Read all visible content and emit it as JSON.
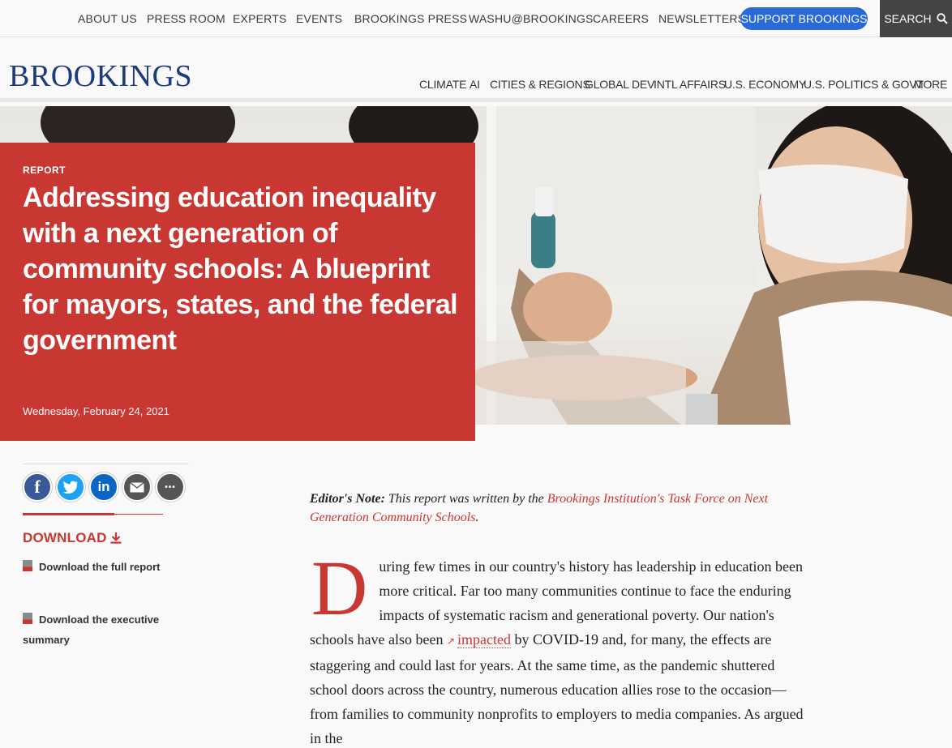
{
  "utility_nav": {
    "items": [
      "ABOUT US",
      "PRESS ROOM",
      "EXPERTS",
      "EVENTS",
      "BROOKINGS PRESS",
      "WASHU@BROOKINGS",
      "CAREERS",
      "NEWSLETTERS"
    ],
    "support_label": "SUPPORT BROOKINGS",
    "search_label": "SEARCH"
  },
  "brand": {
    "logo_text": "BROOKINGS"
  },
  "topic_nav": {
    "items": [
      "CLIMATE",
      "AI",
      "CITIES & REGIONS",
      "GLOBAL DEV",
      "INTL AFFAIRS",
      "U.S. ECONOMY",
      "U.S. POLITICS & GOVT",
      "MORE"
    ]
  },
  "hero": {
    "kicker": "REPORT",
    "title": "Addressing education inequality with a next generation of community schools: A blueprint for mayors, states, and the federal government",
    "date": "Wednesday, February 24, 2021"
  },
  "share": {
    "icons": [
      "facebook-icon",
      "twitter-icon",
      "linkedin-icon",
      "email-icon",
      "more-icon"
    ],
    "glyphs": {
      "facebook": "f",
      "linkedin": "in",
      "more": "•••"
    }
  },
  "download": {
    "heading": "DOWNLOAD",
    "items": [
      "Download the full report",
      "Download the executive summary"
    ]
  },
  "article": {
    "editor_label": "Editor's Note:",
    "editor_text": " This report was written by the ",
    "editor_link": "Brookings Institution's Task Force on Next Generation Community Schools",
    "editor_end": ".",
    "dropcap": "D",
    "p1_a": "uring few times in our country's history has leadership in education been more critical. Far too many communities continue to face the enduring impacts of systematic racism and generational poverty. Our nation's schools have also been ",
    "p1_link": "impacted",
    "p1_b": " by COVID-19 and, for many, the effects are staggering and could last for years. At the same time, as the pandemic shuttered school doors across the country, numerous education allies rose to the occasion—from families to community nonprofits to employers to media companies. As argued in the"
  },
  "colors": {
    "brand_red": "#c93732",
    "brand_navy": "#1d3a7d",
    "support_blue": "#2a6ad6"
  }
}
